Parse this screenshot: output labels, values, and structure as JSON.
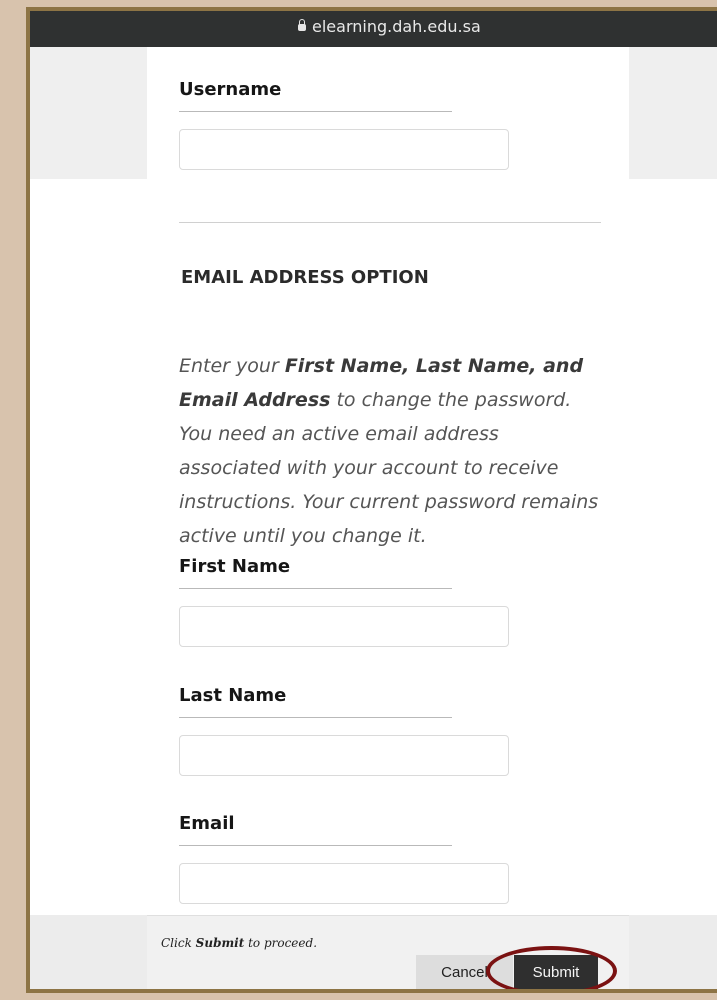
{
  "browser": {
    "url": "elearning.dah.edu.sa"
  },
  "form": {
    "username_label": "Username",
    "section_title": "EMAIL ADDRESS OPTION",
    "desc": {
      "prefix": "Enter your ",
      "bold": "First Name, Last Name, and Email Address",
      "suffix": " to change the password. You need an active email address associated with your account to receive instructions. Your current password remains active until you change it."
    },
    "first_name_label": "First Name",
    "last_name_label": "Last Name",
    "email_label": "Email"
  },
  "footer": {
    "hint_prefix": "Click ",
    "hint_bold": "Submit",
    "hint_suffix": " to proceed.",
    "cancel_label": "Cancel",
    "submit_label": "Submit"
  },
  "colors": {
    "outer_bg": "#d8c3ad",
    "frame": "#8d7445",
    "topbar": "#2f3131",
    "submit_bg": "#2f2f2f",
    "highlight_oval": "#7b1212"
  }
}
